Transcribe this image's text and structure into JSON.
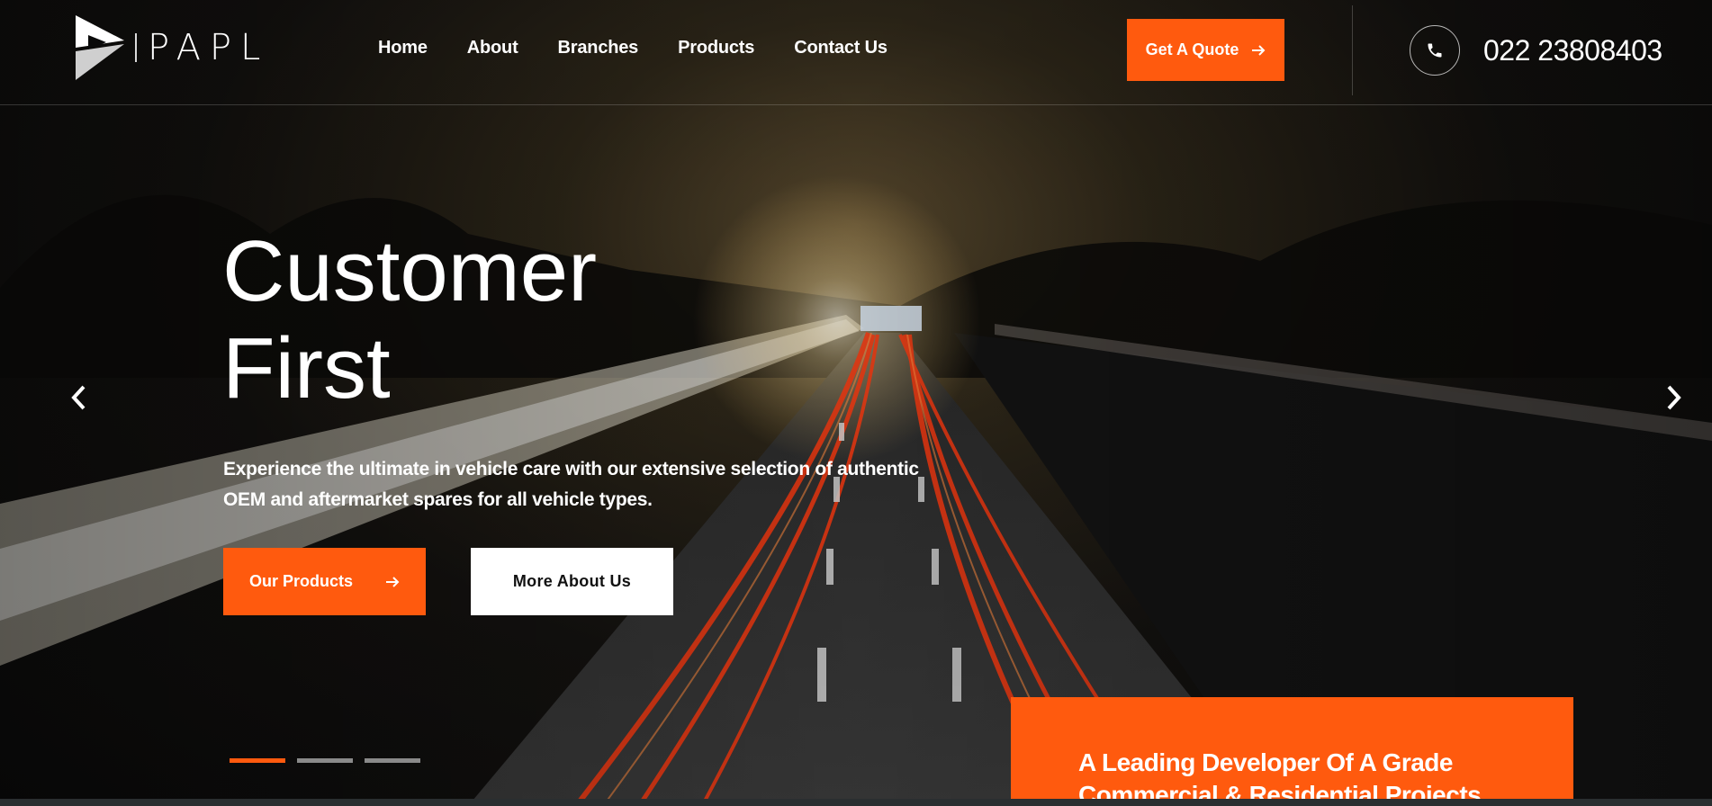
{
  "brand": {
    "name": "PAPL",
    "accent": "#ff5a0e"
  },
  "nav": {
    "items": [
      {
        "label": "Home"
      },
      {
        "label": "About"
      },
      {
        "label": "Branches"
      },
      {
        "label": "Products"
      },
      {
        "label": "Contact Us"
      }
    ]
  },
  "header": {
    "quote_label": "Get A Quote",
    "phone": "022 23808403",
    "icons": {
      "quote_arrow": "arrow-right-icon",
      "phone": "phone-icon"
    }
  },
  "hero": {
    "title_line1": "Customer",
    "title_line2": "First",
    "subtitle": "Experience the ultimate in vehicle care with our extensive selection of authentic OEM and aftermarket spares for all vehicle types.",
    "primary_button": "Our Products",
    "secondary_button": "More About Us",
    "slides": {
      "count": 3,
      "active": 1
    }
  },
  "promo": {
    "text": "A Leading Developer Of A Grade Commercial & Residential Projects"
  }
}
